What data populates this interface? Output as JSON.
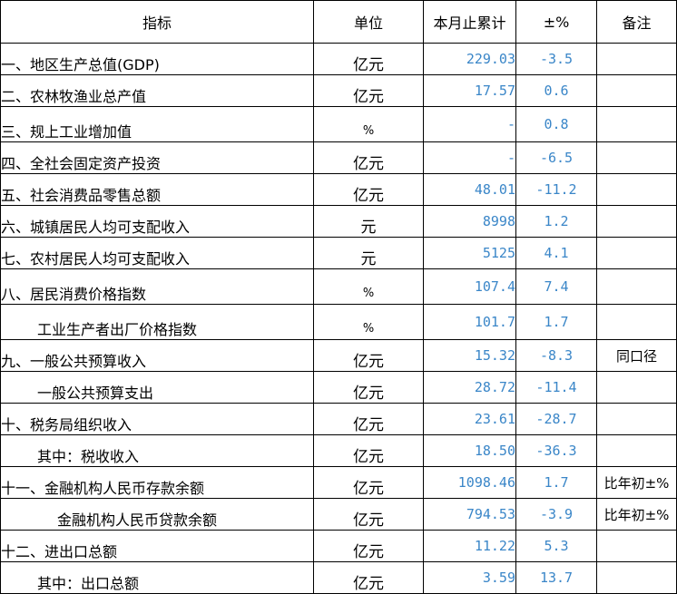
{
  "header": {
    "indicator": "指标",
    "unit": "单位",
    "cumulative": "本月止累计",
    "change": "±%",
    "note": "备注"
  },
  "rows": [
    {
      "name": "一、地区生产总值(GDP)",
      "unit": "亿元",
      "value": "229.03",
      "change": "-3.5",
      "note": "",
      "indent": 0
    },
    {
      "name": "二、农林牧渔业总产值",
      "unit": "亿元",
      "value": "17.57",
      "change": "0.6",
      "note": "",
      "indent": 0
    },
    {
      "name": "三、规上工业增加值",
      "unit": "%",
      "value": "-",
      "change": "0.8",
      "note": "",
      "indent": 0
    },
    {
      "name": "四、全社会固定资产投资",
      "unit": "亿元",
      "value": "-",
      "change": "-6.5",
      "note": "",
      "indent": 0
    },
    {
      "name": "五、社会消费品零售总额",
      "unit": "亿元",
      "value": "48.01",
      "change": "-11.2",
      "note": "",
      "indent": 0
    },
    {
      "name": "六、城镇居民人均可支配收入",
      "unit": "元",
      "value": "8998",
      "change": "1.2",
      "note": "",
      "indent": 0
    },
    {
      "name": "七、农村居民人均可支配收入",
      "unit": "元",
      "value": "5125",
      "change": "4.1",
      "note": "",
      "indent": 0
    },
    {
      "name": "八、居民消费价格指数",
      "unit": "%",
      "value": "107.4",
      "change": "7.4",
      "note": "",
      "indent": 0
    },
    {
      "name": "工业生产者出厂价格指数",
      "unit": "%",
      "value": "101.7",
      "change": "1.7",
      "note": "",
      "indent": 1
    },
    {
      "name": "九、一般公共预算收入",
      "unit": "亿元",
      "value": "15.32",
      "change": "-8.3",
      "note": "同口径",
      "indent": 0
    },
    {
      "name": "一般公共预算支出",
      "unit": "亿元",
      "value": "28.72",
      "change": "-11.4",
      "note": "",
      "indent": 1
    },
    {
      "name": "十、税务局组织收入",
      "unit": "亿元",
      "value": "23.61",
      "change": "-28.7",
      "note": "",
      "indent": 0
    },
    {
      "name": "其中：税收收入",
      "unit": "亿元",
      "value": "18.50",
      "change": "-36.3",
      "note": "",
      "indent": 1
    },
    {
      "name": "十一、金融机构人民币存款余额",
      "unit": "亿元",
      "value": "1098.46",
      "change": "1.7",
      "note": "比年初±%",
      "indent": 0
    },
    {
      "name": "金融机构人民币贷款余额",
      "unit": "亿元",
      "value": "794.53",
      "change": "-3.9",
      "note": "比年初±%",
      "indent": 2
    },
    {
      "name": "十二、进出口总额",
      "unit": "亿元",
      "value": "11.22",
      "change": "5.3",
      "note": "",
      "indent": 0
    },
    {
      "name": "其中：出口总额",
      "unit": "亿元",
      "value": "3.59",
      "change": "13.7",
      "note": "",
      "indent": 1
    }
  ]
}
